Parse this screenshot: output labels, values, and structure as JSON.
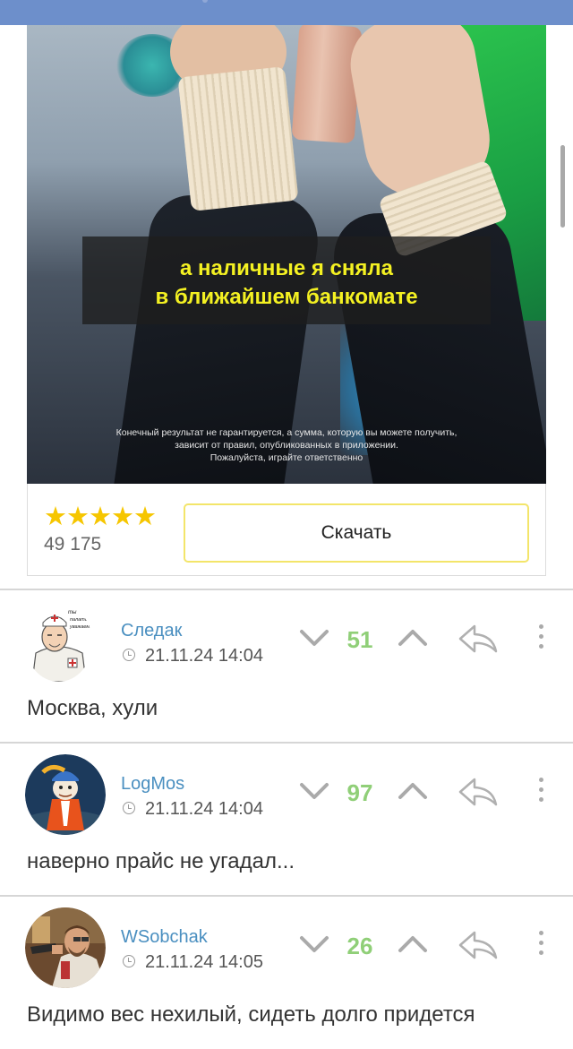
{
  "ad": {
    "caption_line1": "а наличные я сняла",
    "caption_line2": "в ближайшем банкомате",
    "disclaimer_line1": "Конечный результат не гарантируется, а сумма, которую вы можете получить,",
    "disclaimer_line2": "зависит от правил, опубликованных в приложении.",
    "disclaimer_line3": "Пожалуйста, играйте ответственно",
    "stars": "★★★★★",
    "rating_count": "49 175",
    "download_label": "Скачать",
    "star_color": "#f6c600",
    "caption_color": "#f4f122"
  },
  "comments": [
    {
      "username": "Следак",
      "timestamp": "21.11.24 14:04",
      "score": "51",
      "text": "Москва, хули",
      "avatar_caption": "ты палаты уважаем.",
      "avatar_icon": "doctor-cartoon-avatar"
    },
    {
      "username": "LogMos",
      "timestamp": "21.11.24 14:04",
      "score": "97",
      "text": "наверно прайс не угадал...",
      "avatar_icon": "cartoon-character-avatar"
    },
    {
      "username": "WSobchak",
      "timestamp": "21.11.24 14:05",
      "score": "26",
      "text": "Видимо вес нехилый, сидеть долго придется",
      "avatar_icon": "man-with-gun-avatar"
    }
  ],
  "colors": {
    "username": "#4a8fc0",
    "score_positive": "#90cf78",
    "top_bar": "#6d8fcb"
  }
}
